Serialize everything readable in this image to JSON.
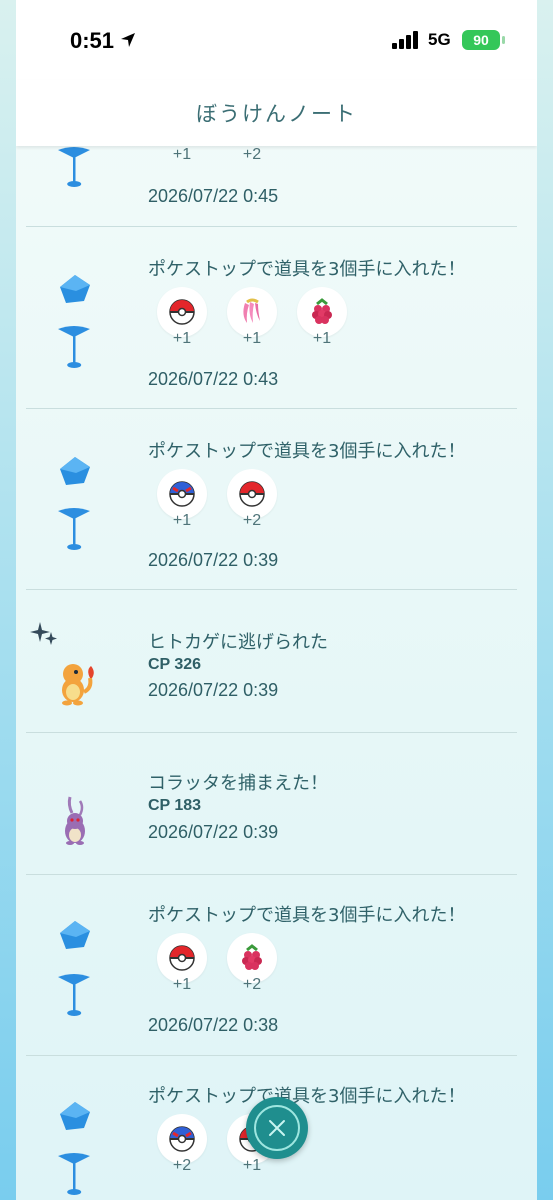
{
  "status_bar": {
    "time": "0:51",
    "network": "5G",
    "battery": "90"
  },
  "header": {
    "title": "ぼうけんノート"
  },
  "entries": [
    {
      "type": "pokestop",
      "items": [
        {
          "icon": "item-icon",
          "count": "+1"
        },
        {
          "icon": "item-icon",
          "count": "+2"
        }
      ],
      "date": "2026/07/22 0:45"
    },
    {
      "type": "pokestop",
      "title": "ポケストップで道具を3個手に入れた！",
      "items": [
        {
          "icon": "poke-ball-icon",
          "count": "+1"
        },
        {
          "icon": "nanab-berry-icon",
          "count": "+1"
        },
        {
          "icon": "razz-berry-icon",
          "count": "+1"
        }
      ],
      "date": "2026/07/22 0:43"
    },
    {
      "type": "pokestop",
      "title": "ポケストップで道具を3個手に入れた！",
      "items": [
        {
          "icon": "great-ball-icon",
          "count": "+1"
        },
        {
          "icon": "poke-ball-icon",
          "count": "+2"
        }
      ],
      "date": "2026/07/22 0:39"
    },
    {
      "type": "flee",
      "title": "ヒトカゲに逃げられた",
      "cp": "CP 326",
      "date": "2026/07/22 0:39",
      "pokemon_icon": "charmander-icon",
      "shiny": true
    },
    {
      "type": "catch",
      "title": "コラッタを捕まえた！",
      "cp": "CP 183",
      "date": "2026/07/22 0:39",
      "pokemon_icon": "rattata-icon"
    },
    {
      "type": "pokestop",
      "title": "ポケストップで道具を3個手に入れた！",
      "items": [
        {
          "icon": "poke-ball-icon",
          "count": "+1"
        },
        {
          "icon": "razz-berry-icon",
          "count": "+2"
        }
      ],
      "date": "2026/07/22 0:38"
    },
    {
      "type": "pokestop",
      "title": "ポケストップで道具を3個手に入れた！",
      "items": [
        {
          "icon": "great-ball-icon",
          "count": "+2"
        },
        {
          "icon": "poke-ball-icon",
          "count": "+1"
        }
      ]
    }
  ],
  "colors": {
    "accent": "#1f8e8e",
    "text": "#2f6168",
    "pokestop": "#2c8ee0"
  }
}
